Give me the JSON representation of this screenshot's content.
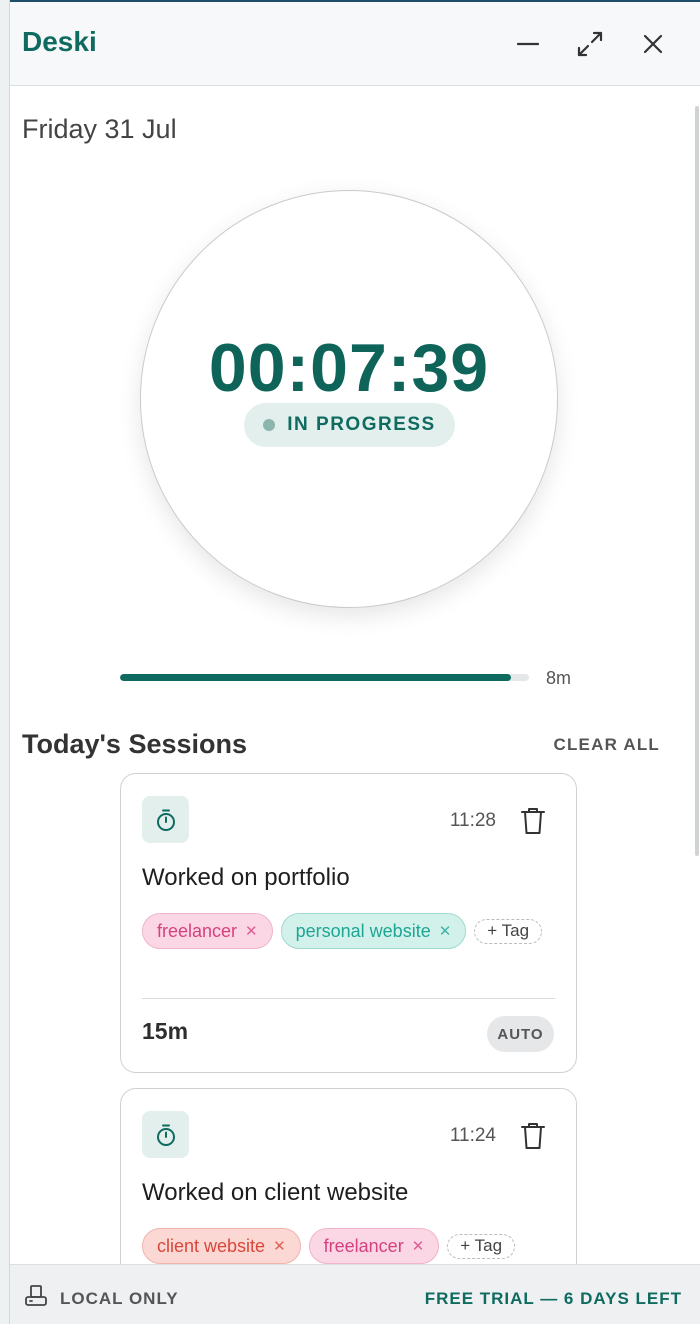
{
  "app": {
    "title": "Deski"
  },
  "window_controls": {
    "minimize_icon": "minimize-icon",
    "maximize_icon": "expand-icon",
    "close_icon": "close-icon"
  },
  "date": "Friday 31 Jul",
  "timer": {
    "value": "00:07:39",
    "status": "IN PROGRESS"
  },
  "progress": {
    "fraction": 0.955,
    "label": "8m"
  },
  "sessions": {
    "title": "Today's Sessions",
    "clear_label": "CLEAR ALL",
    "add_tag_label": "+ Tag",
    "items": [
      {
        "time": "11:28",
        "title": "Worked on portfolio",
        "tags": [
          {
            "label": "freelancer",
            "color": "pink"
          },
          {
            "label": "personal website",
            "color": "teal"
          }
        ],
        "duration": "15m",
        "badge": "AUTO"
      },
      {
        "time": "11:24",
        "title": "Worked on client website",
        "tags": [
          {
            "label": "client website",
            "color": "red"
          },
          {
            "label": "freelancer",
            "color": "pink"
          }
        ]
      }
    ]
  },
  "footer": {
    "left": "LOCAL ONLY",
    "right": "FREE TRIAL — 6 DAYS LEFT"
  },
  "colors": {
    "accent": "#0f6b60",
    "tag_pink": "#d6407f",
    "tag_teal": "#1ca693",
    "tag_red": "#d9473b"
  }
}
